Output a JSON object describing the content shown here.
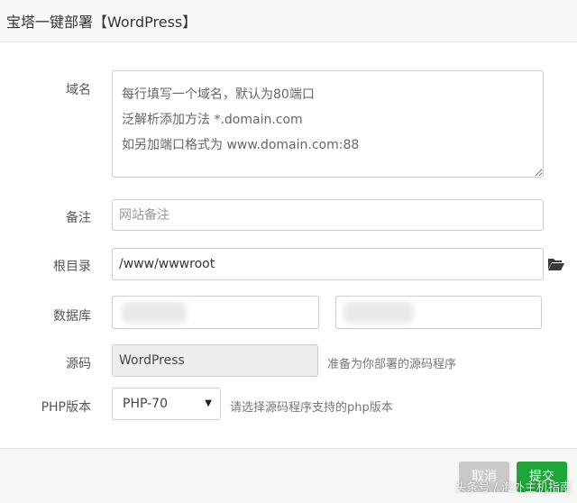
{
  "dialog": {
    "title": "宝塔一键部署【WordPress】"
  },
  "form": {
    "domain": {
      "label": "域名",
      "placeholder": "每行填写一个域名，默认为80端口\n泛解析添加方法 *.domain.com\n如另加端口格式为 www.domain.com:88"
    },
    "note": {
      "label": "备注",
      "placeholder": "网站备注"
    },
    "root": {
      "label": "根目录",
      "value": "/www/wwwroot",
      "icon": "folder-open-icon"
    },
    "database": {
      "label": "数据库"
    },
    "source": {
      "label": "源码",
      "value": "WordPress",
      "hint": "准备为你部署的源码程序"
    },
    "php": {
      "label": "PHP版本",
      "selected": "PHP-70",
      "hint": "请选择源码程序支持的php版本"
    }
  },
  "footer": {
    "cancel_label": "取消",
    "submit_label": "提交",
    "watermark": "头条号 / 海外主机指南"
  },
  "colors": {
    "primary": "#20a53a",
    "cancel": "#c9c9c9"
  }
}
